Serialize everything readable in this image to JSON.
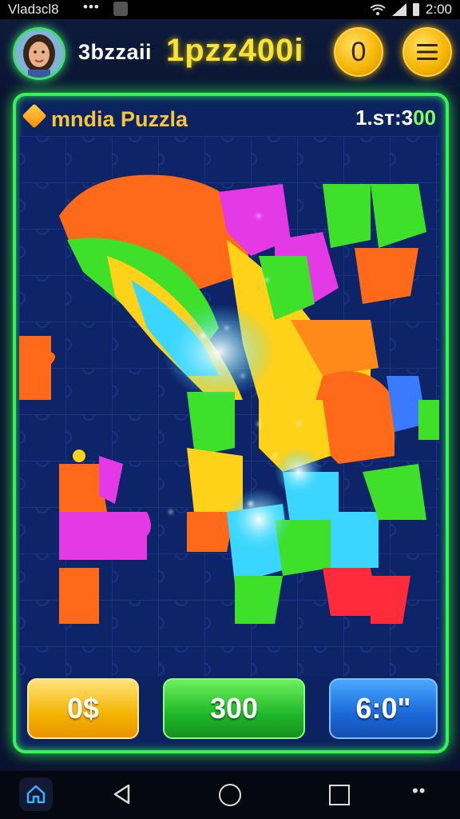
{
  "status_bar": {
    "left_text": "Vlаdзcl8",
    "dots": "•••",
    "time": "2:00"
  },
  "header": {
    "title_part1": "3bzzaii",
    "title_part2": "1pzz400i",
    "coin_label": "0",
    "menu_icon": "hamburger-icon"
  },
  "board": {
    "title": "mndia Puzzla",
    "score_white": "1.sт:3",
    "score_green": "00",
    "colors": {
      "frame": "#3af05a",
      "background": "#0d2260",
      "orange": "#ff6a1a",
      "yellow": "#ffd21a",
      "green": "#3ee02a",
      "magenta": "#e43ae6",
      "cyan": "#3ad6ff",
      "red": "#ff2a3a"
    }
  },
  "buttons": {
    "yellow_label": "0$",
    "green_label": "300",
    "blue_label": "6:0\""
  },
  "nav": {
    "home_icon": "home-icon",
    "back_icon": "back-triangle-icon",
    "home_circle_icon": "home-circle-icon",
    "recents_icon": "recents-square-icon",
    "more_icon": "more-dots-icon"
  }
}
